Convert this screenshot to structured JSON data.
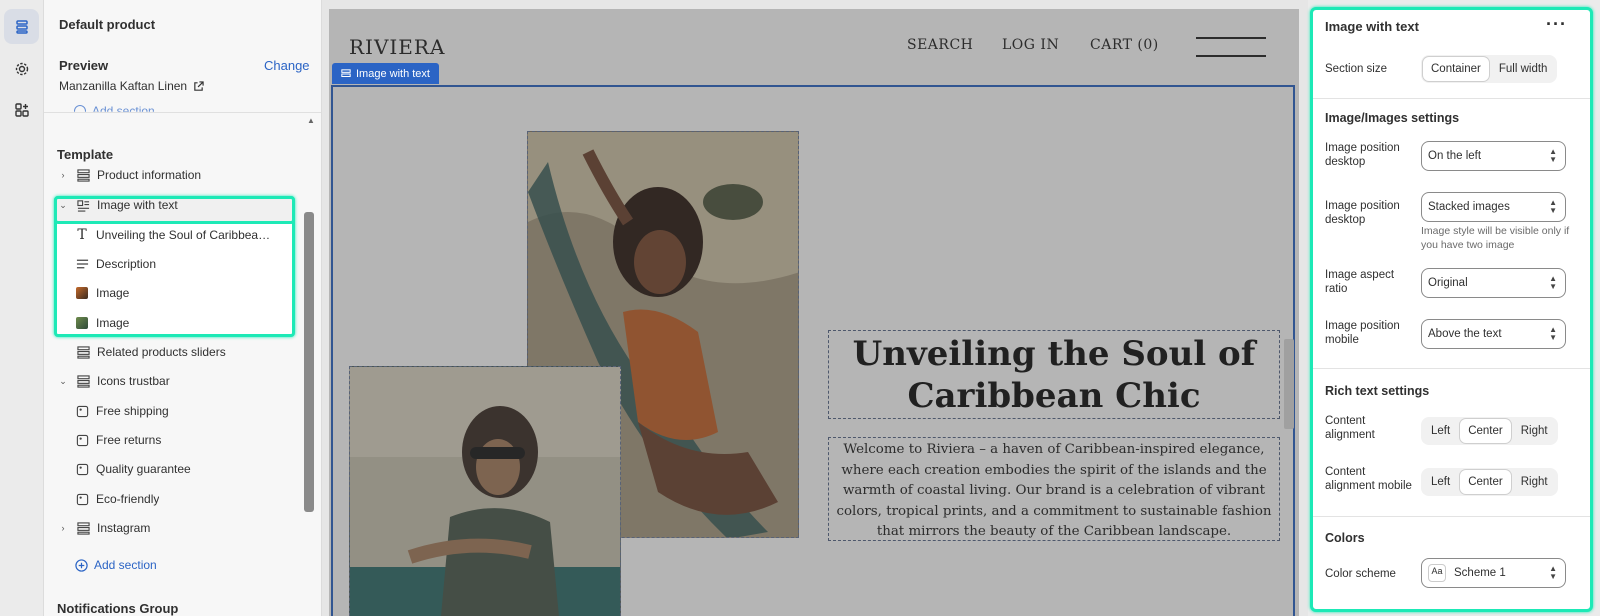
{
  "rail": {
    "items": [
      "sections-icon",
      "gear-icon",
      "apps-icon"
    ]
  },
  "sidebar": {
    "title": "Default product",
    "preview_label": "Preview",
    "change_label": "Change",
    "product_name": "Manzanilla Kaftan Linen",
    "add_section_top": "Add section",
    "template_label": "Template",
    "items": [
      {
        "label": "Product information"
      },
      {
        "label": "Image with text"
      },
      {
        "label": "Unveiling the Soul of Caribbean ..."
      },
      {
        "label": "Description"
      },
      {
        "label": "Image"
      },
      {
        "label": "Image"
      },
      {
        "label": "Related products sliders"
      },
      {
        "label": "Icons trustbar"
      },
      {
        "label": "Free shipping"
      },
      {
        "label": "Free returns"
      },
      {
        "label": "Quality guarantee"
      },
      {
        "label": "Eco-friendly"
      },
      {
        "label": "Instagram"
      }
    ],
    "add_section_bottom": "Add section",
    "notifications_label": "Notifications Group"
  },
  "store": {
    "brand": "RIVIERA",
    "nav": {
      "search": "SEARCH",
      "login": "LOG IN",
      "cart": "CART (0)"
    },
    "section_tab": "Image with text",
    "heading": "Unveiling the Soul of Caribbean Chic",
    "description": "Welcome to Riviera – a haven of Caribbean-inspired elegance, where each creation embodies the spirit of the islands and the warmth of coastal living. Our brand is a celebration of vibrant colors, tropical prints, and a commitment to sustainable fashion that mirrors the beauty of the Caribbean landscape."
  },
  "panel": {
    "title": "Image with text",
    "section_size_label": "Section size",
    "section_size_options": [
      "Container",
      "Full width"
    ],
    "section_size_selected": "Container",
    "images_heading": "Image/Images settings",
    "image_position_desktop_label": "Image position desktop",
    "image_position_desktop_value": "On the left",
    "image_style_label": "Image position desktop",
    "image_style_value": "Stacked images",
    "image_style_hint": "Image style will be visible only if you have two image",
    "aspect_ratio_label": "Image aspect ratio",
    "aspect_ratio_value": "Original",
    "image_position_mobile_label": "Image position mobile",
    "image_position_mobile_value": "Above the text",
    "rich_text_heading": "Rich text settings",
    "content_alignment_label": "Content alignment",
    "content_alignment_mobile_label": "Content alignment mobile",
    "alignment_options": [
      "Left",
      "Center",
      "Right"
    ],
    "alignment_selected": "Center",
    "colors_heading": "Colors",
    "color_scheme_label": "Color scheme",
    "color_scheme_value": "Scheme 1",
    "color_scheme_swatch": "Aa"
  },
  "colors": {
    "accent": "#2b64c5",
    "highlight": "#1de9b6"
  }
}
